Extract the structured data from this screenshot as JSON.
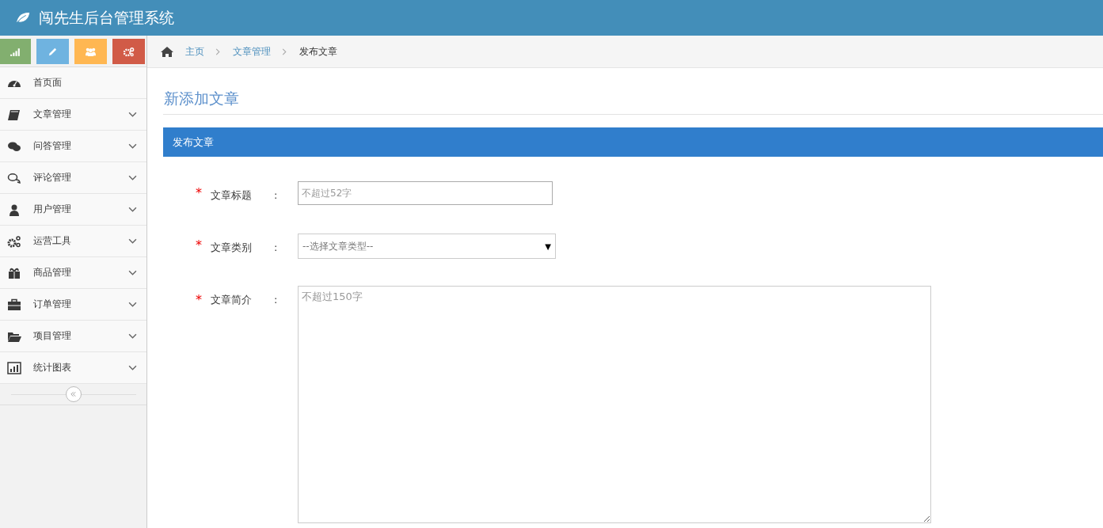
{
  "header": {
    "title": "闯先生后台管理系统"
  },
  "shortcuts": [
    {
      "color": "#82af6f"
    },
    {
      "color": "#6fb3e0"
    },
    {
      "color": "#ffb752"
    },
    {
      "color": "#d15b47"
    }
  ],
  "sidebar": {
    "items": [
      {
        "label": "首页面",
        "expandable": false
      },
      {
        "label": "文章管理",
        "expandable": true
      },
      {
        "label": "问答管理",
        "expandable": true
      },
      {
        "label": "评论管理",
        "expandable": true
      },
      {
        "label": "用户管理",
        "expandable": true
      },
      {
        "label": "运营工具",
        "expandable": true
      },
      {
        "label": "商品管理",
        "expandable": true
      },
      {
        "label": "订单管理",
        "expandable": true
      },
      {
        "label": "项目管理",
        "expandable": true
      },
      {
        "label": "统计图表",
        "expandable": true
      }
    ]
  },
  "breadcrumb": [
    {
      "label": "主页",
      "link": true
    },
    {
      "label": "文章管理",
      "link": true
    },
    {
      "label": "发布文章",
      "link": false
    }
  ],
  "page_title": "新添加文章",
  "panel": {
    "title": "发布文章",
    "fields": [
      {
        "kind": "text",
        "required_mark": "*",
        "label": "文章标题",
        "colon": ":",
        "placeholder": "不超过52字"
      },
      {
        "kind": "select",
        "required_mark": "*",
        "label": "文章类别",
        "colon": ":",
        "value": "--选择文章类型--",
        "arrow": "▼"
      },
      {
        "kind": "textarea",
        "required_mark": "*",
        "label": "文章简介",
        "colon": ":",
        "placeholder": "不超过150字"
      }
    ]
  }
}
